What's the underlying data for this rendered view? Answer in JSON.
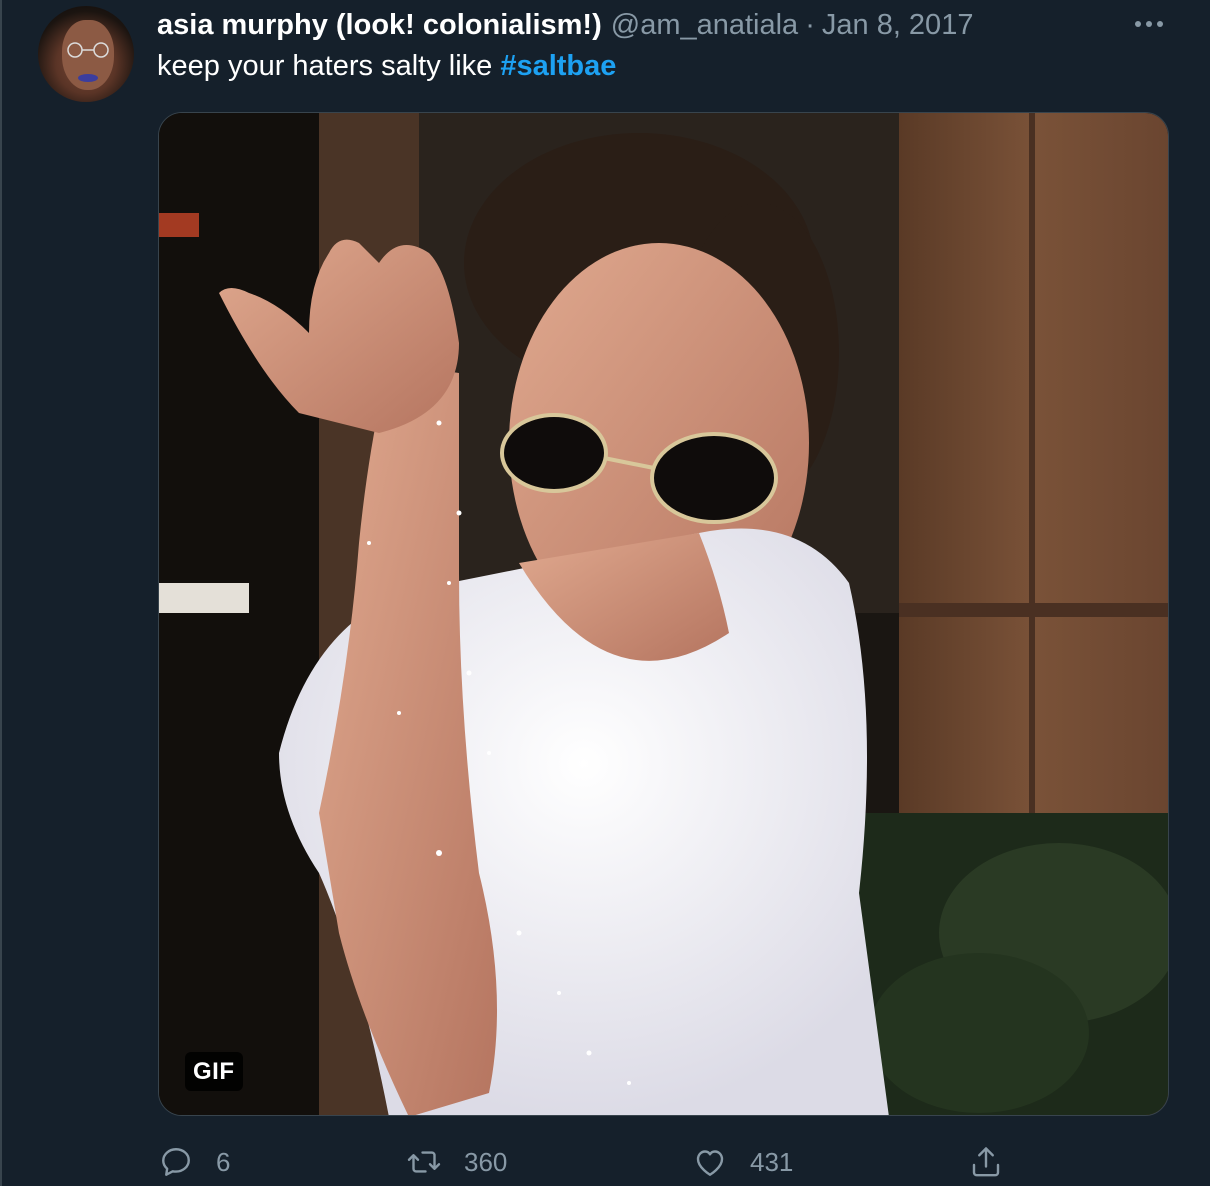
{
  "tweet": {
    "author": {
      "display_name": "asia murphy (look! colonialism!)",
      "handle": "@am_anatiala",
      "separator": "·",
      "date": "Jan 8, 2017",
      "avatar_icon": "profile-photo"
    },
    "text_prefix": "keep your haters salty like ",
    "hashtag": "#saltbae",
    "media": {
      "type": "gif",
      "badge": "GIF"
    },
    "more_icon": "ellipsis-icon",
    "actions": {
      "reply": {
        "icon": "reply-icon",
        "count": "6"
      },
      "retweet": {
        "icon": "retweet-icon",
        "count": "360"
      },
      "like": {
        "icon": "heart-icon",
        "count": "431"
      },
      "share": {
        "icon": "share-icon"
      }
    },
    "colors": {
      "background": "#15202b",
      "text_primary": "#ffffff",
      "text_secondary": "#8899a6",
      "link": "#1da1f2",
      "border": "#38444d"
    }
  }
}
